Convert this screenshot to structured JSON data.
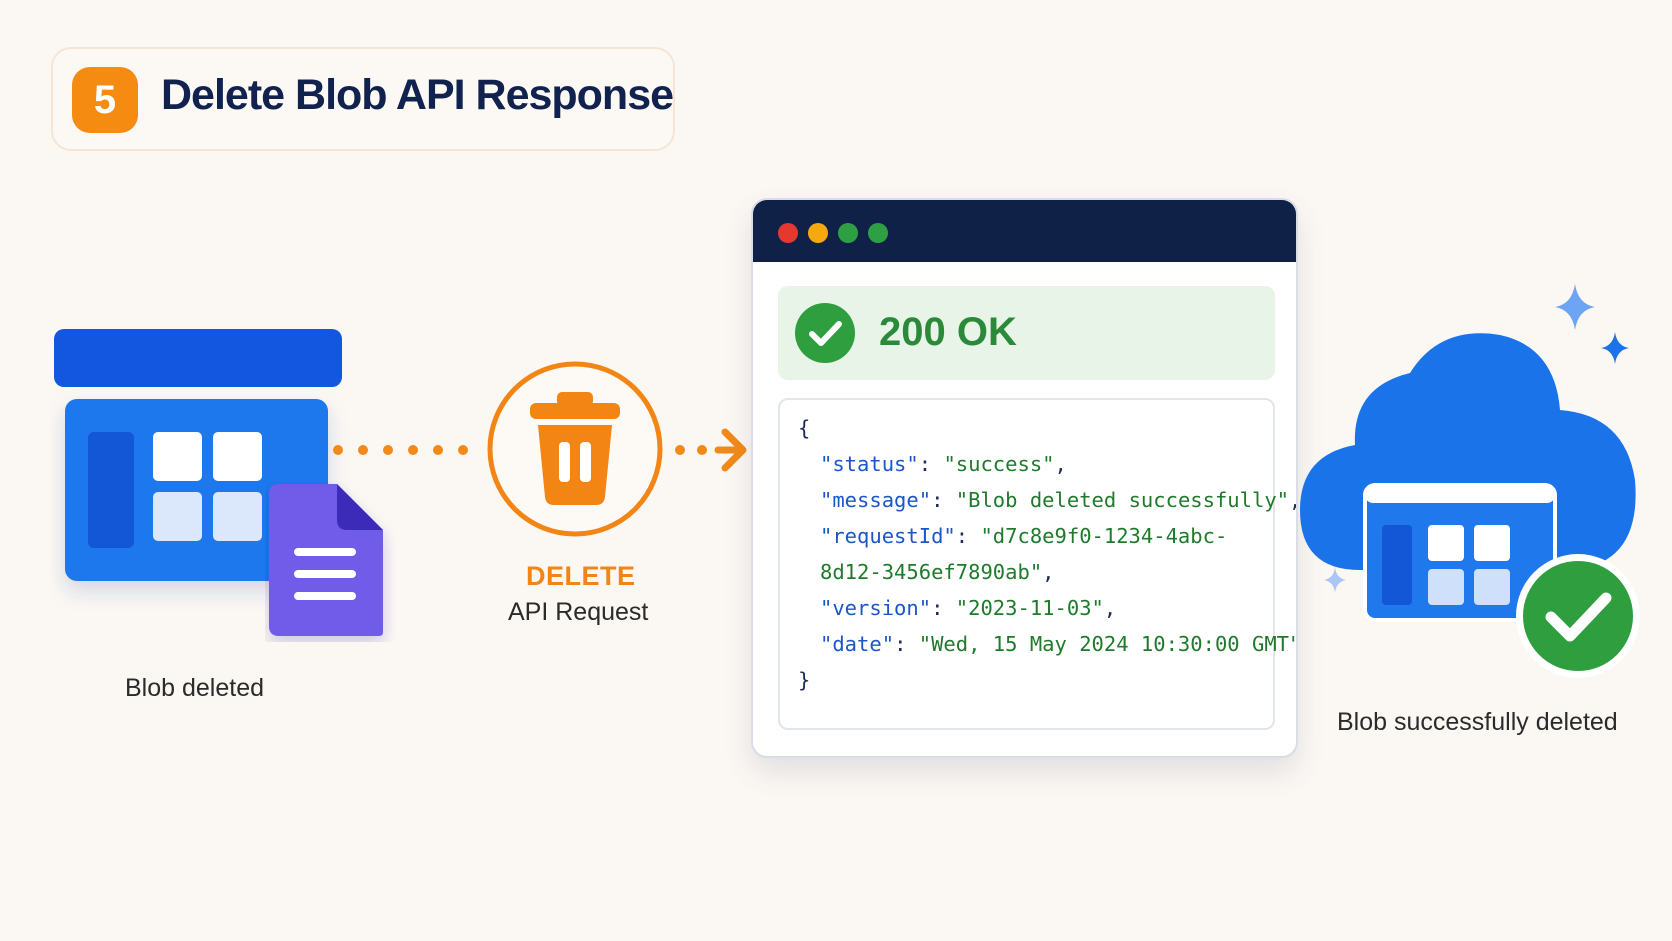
{
  "header": {
    "step_number": "5",
    "title": "Delete Blob API Response"
  },
  "left": {
    "caption": "Blob deleted",
    "icons": [
      "storage-container-icon",
      "document-icon"
    ]
  },
  "request": {
    "method": "DELETE",
    "caption": "API Request",
    "icon": "trash-icon"
  },
  "response": {
    "status": "200 OK",
    "json": {
      "open_brace": "{",
      "close_brace": "}",
      "status_key": "\"status\"",
      "status_value": "\"success\"",
      "message_key": "\"message\"",
      "message_value": "\"Blob deleted successfully\"",
      "requestId_key": "\"requestId\"",
      "requestId_value_line1": "\"d7c8e9f0-1234-4abc-",
      "requestId_value_line2": "8d12-3456ef7890ab\"",
      "version_key": "\"version\"",
      "version_value": "\"2023-11-03\"",
      "date_key": "\"date\"",
      "date_value": "\"Wed, 15 May 2024 10:30:00 GMT\""
    }
  },
  "right": {
    "caption": "Blob successfully deleted",
    "icons": [
      "cloud-icon",
      "storage-container-icon",
      "checkmark-icon",
      "sparkle-icon"
    ]
  },
  "colors": {
    "accent_orange": "#f68b12",
    "navy": "#0f2147",
    "azure_blue": "#1a73e8",
    "success_green": "#2ea043",
    "doc_purple": "#6f5ce8",
    "background": "#fbf8f4"
  }
}
